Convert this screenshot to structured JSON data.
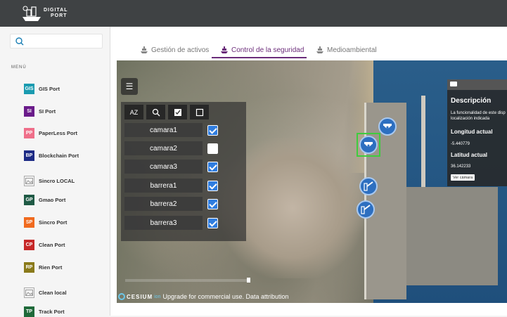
{
  "logo": {
    "line1": "DIGITAL",
    "line2": "PORT"
  },
  "sidebar": {
    "search_placeholder": "",
    "menu_title": "MENÚ",
    "items": [
      {
        "badge": "GIS",
        "label": "GIS Port",
        "color": "#1a9bb0"
      },
      {
        "badge": "SI",
        "label": "SI Port",
        "color": "#6a1b8a"
      },
      {
        "badge": "PP",
        "label": "PaperLess Port",
        "color": "#ef6f8a"
      },
      {
        "badge": "BP",
        "label": "Blockchain Port",
        "color": "#1c2a85"
      },
      {
        "badge": "",
        "label": "Sincro LOCAL",
        "color": ""
      },
      {
        "badge": "GP",
        "label": "Gmao Port",
        "color": "#1f5a45"
      },
      {
        "badge": "SP",
        "label": "Sincro Port",
        "color": "#f06a1e"
      },
      {
        "badge": "CP",
        "label": "Clean Port",
        "color": "#c62828"
      },
      {
        "badge": "RP",
        "label": "Rien Port",
        "color": "#8a7a1a"
      },
      {
        "badge": "",
        "label": "Clean local",
        "color": ""
      },
      {
        "badge": "TP",
        "label": "Track Port",
        "color": "#1f6a3a"
      }
    ]
  },
  "tabs": [
    {
      "label": "Gestión de activos",
      "active": false
    },
    {
      "label": "Control de la seguridad",
      "active": true
    },
    {
      "label": "Medioambiental",
      "active": false
    }
  ],
  "layer_panel": {
    "tools": [
      "sort-az",
      "search",
      "check-all",
      "uncheck-all"
    ],
    "tool_glyph_sort": "AZ",
    "rows": [
      {
        "name": "camara1",
        "checked": true
      },
      {
        "name": "camara2",
        "checked": false
      },
      {
        "name": "camara3",
        "checked": true
      },
      {
        "name": "barrera1",
        "checked": true
      },
      {
        "name": "barrera2",
        "checked": true
      },
      {
        "name": "barrera3",
        "checked": true
      }
    ]
  },
  "description": {
    "title": "Descripción",
    "text_line1": "La funcionalidad de este disp",
    "text_line2": "localización indicada",
    "longitude_label": "Longitud actual",
    "longitude_value": "-5.440779",
    "latitude_label": "Latitud actual",
    "latitude_value": "36.142233",
    "button": "Ver cámara"
  },
  "credits": {
    "brand": "CESIUM",
    "ion": "ion",
    "text": "Upgrade for commercial use. Data attribution"
  },
  "colors": {
    "accent": "#6b2c7a",
    "marker": "#2d6fc0",
    "selection": "#3ecc3e"
  }
}
